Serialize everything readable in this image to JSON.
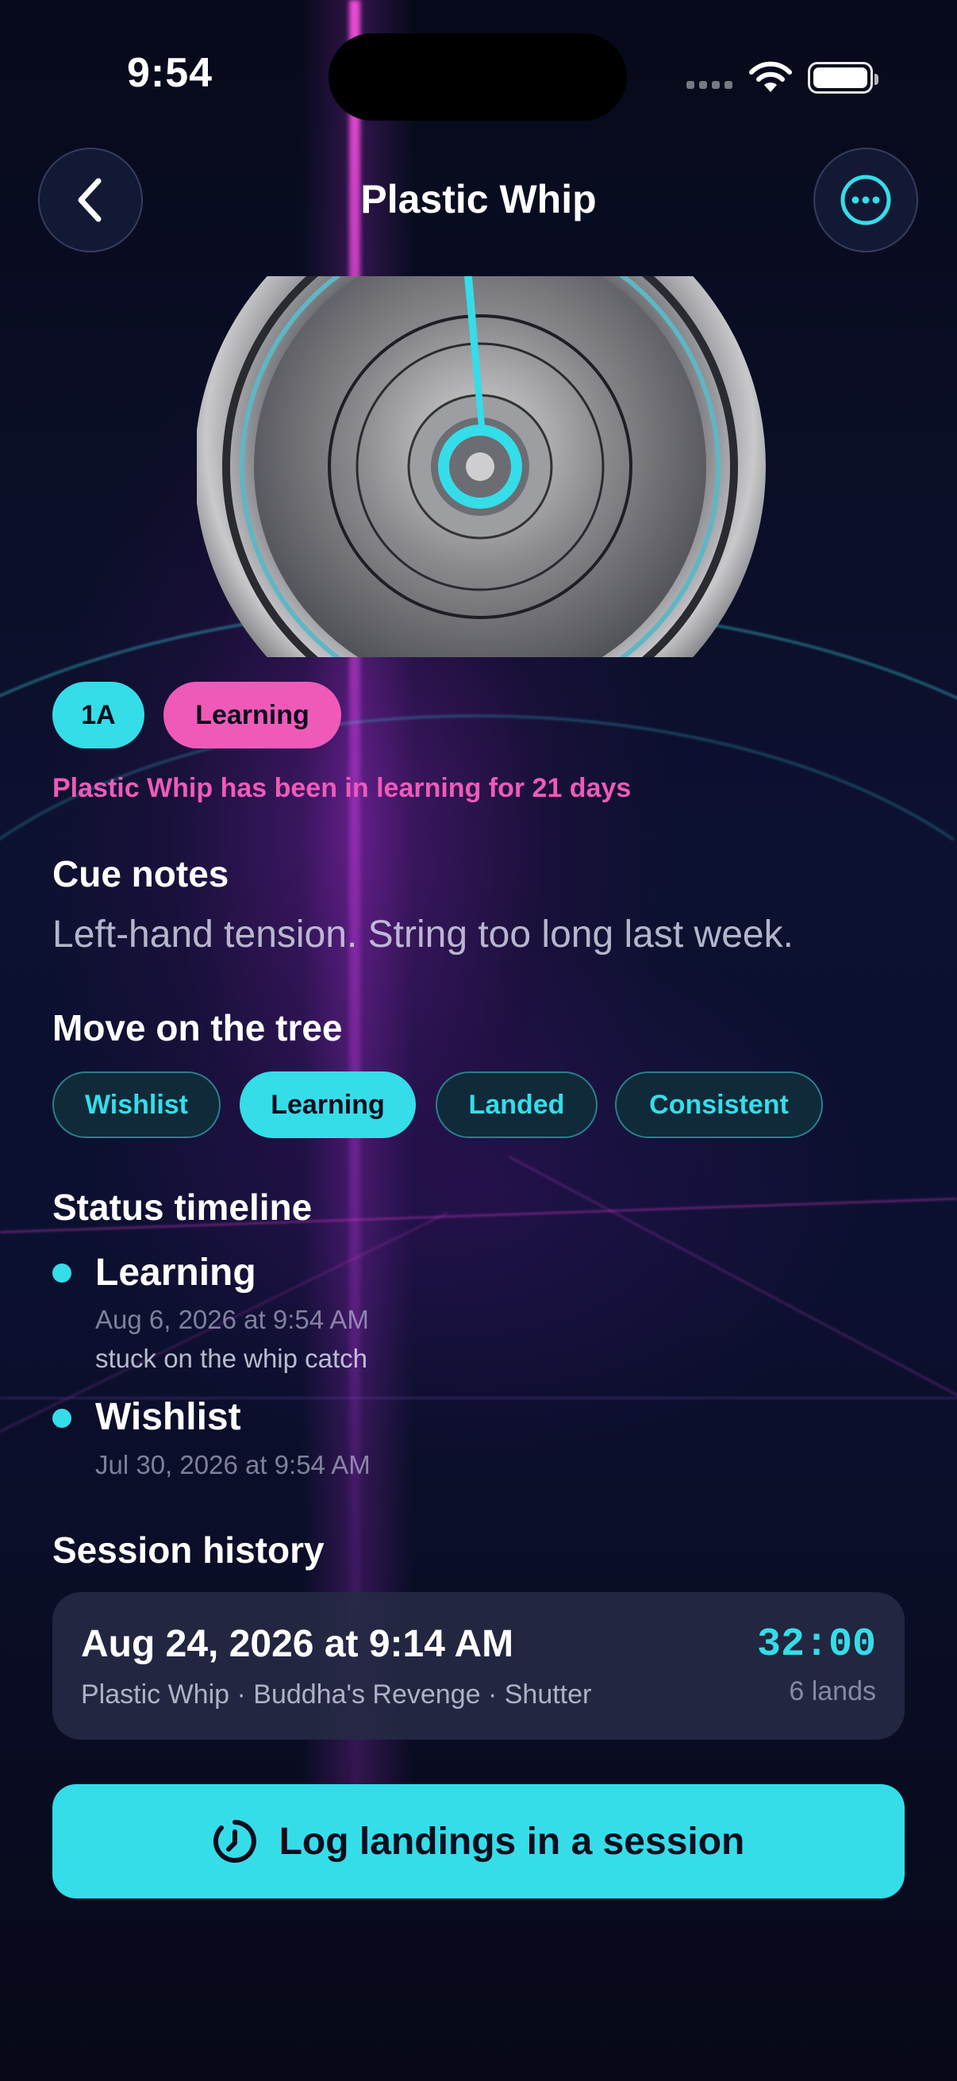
{
  "status_bar": {
    "time": "9:54"
  },
  "header": {
    "title": "Plastic Whip"
  },
  "hero": {
    "image_description": "yo-yo"
  },
  "tags": {
    "type": "1A",
    "status": "Learning"
  },
  "learning_note": "Plastic Whip has been in learning for 21 days",
  "cue_notes": {
    "heading": "Cue notes",
    "text": "Left-hand tension. String too long last week."
  },
  "tree": {
    "heading": "Move on the tree",
    "options": [
      {
        "label": "Wishlist",
        "active": false
      },
      {
        "label": "Learning",
        "active": true
      },
      {
        "label": "Landed",
        "active": false
      },
      {
        "label": "Consistent",
        "active": false
      }
    ]
  },
  "timeline": {
    "heading": "Status timeline",
    "entries": [
      {
        "status": "Learning",
        "date": "Aug 6, 2026 at 9:54 AM",
        "note": "stuck on the whip catch"
      },
      {
        "status": "Wishlist",
        "date": "Jul 30, 2026 at 9:54 AM",
        "note": ""
      }
    ]
  },
  "sessions": {
    "heading": "Session history",
    "items": [
      {
        "date": "Aug 24, 2026 at 9:14 AM",
        "tricks": "Plastic Whip · Buddha's Revenge · Shutter",
        "duration": "32:00",
        "lands": "6 lands"
      }
    ]
  },
  "cta": {
    "label": "Log landings in a session",
    "icon": "timer-icon"
  },
  "colors": {
    "accent": "#35dde8",
    "pink": "#ef5ab9",
    "background": "#0a0d1e"
  }
}
